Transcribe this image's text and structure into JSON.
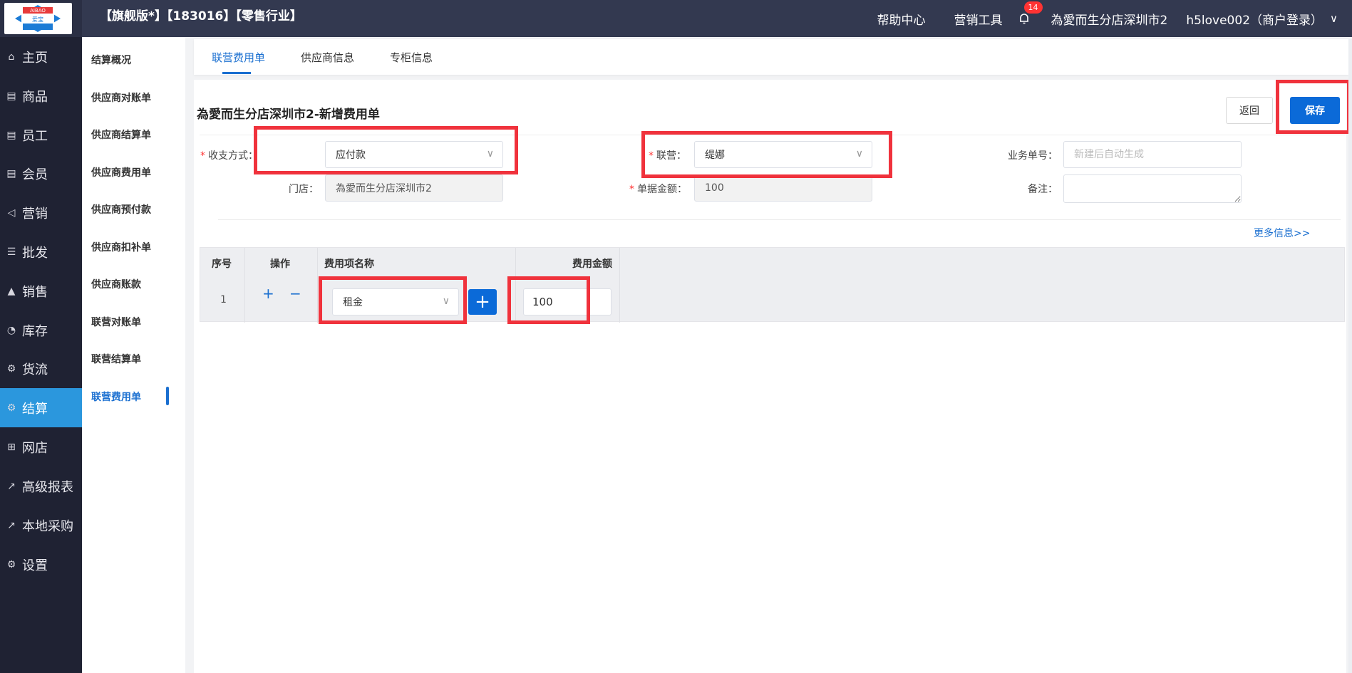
{
  "logo": {
    "top_text": "AIBAO",
    "bottom_text": "爱宝"
  },
  "header": {
    "brand": "【旗舰版*】【183016】【零售行业】",
    "help": "帮助中心",
    "marketing_tools": "营销工具",
    "notification_count": "14",
    "store": "為愛而生分店深圳市2",
    "user": "h5love002（商户登录）",
    "user_chevron": "∨"
  },
  "nav": [
    {
      "label": "主页",
      "icon": "home-icon",
      "glyph": "⌂"
    },
    {
      "label": "商品",
      "icon": "goods-icon",
      "glyph": "▤"
    },
    {
      "label": "员工",
      "icon": "staff-icon",
      "glyph": "▤"
    },
    {
      "label": "会员",
      "icon": "member-icon",
      "glyph": "▤"
    },
    {
      "label": "营销",
      "icon": "megaphone-icon",
      "glyph": "◁"
    },
    {
      "label": "批发",
      "icon": "wholesale-icon",
      "glyph": "☰"
    },
    {
      "label": "销售",
      "icon": "sales-chart-icon",
      "glyph": "▲"
    },
    {
      "label": "库存",
      "icon": "pie-chart-icon",
      "glyph": "◔"
    },
    {
      "label": "货流",
      "icon": "logistics-icon",
      "glyph": "⚙"
    },
    {
      "label": "结算",
      "icon": "settlement-icon",
      "glyph": "⚙"
    },
    {
      "label": "网店",
      "icon": "gift-icon",
      "glyph": "⊞"
    },
    {
      "label": "高级报表",
      "icon": "line-chart-icon",
      "glyph": "↗"
    },
    {
      "label": "本地采购",
      "icon": "purchase-chart-icon",
      "glyph": "↗"
    },
    {
      "label": "设置",
      "icon": "gear-icon",
      "glyph": "⚙"
    }
  ],
  "subnav": [
    "结算概况",
    "供应商对账单",
    "供应商结算单",
    "供应商费用单",
    "供应商预付款",
    "供应商扣补单",
    "供应商账款",
    "联营对账单",
    "联营结算单",
    "联营费用单"
  ],
  "tabs": [
    "联营费用单",
    "供应商信息",
    "专柜信息"
  ],
  "page": {
    "title": "為愛而生分店深圳市2-新增费用单",
    "back_label": "返回",
    "save_label": "保存"
  },
  "form": {
    "payment_method_label": "收支方式：",
    "payment_method_value": "应付款",
    "joint_label": "联营：",
    "joint_value": "缇娜",
    "bizno_label": "业务单号：",
    "bizno_placeholder": "新建后自动生成",
    "store_label": "门店：",
    "store_value": "為愛而生分店深圳市2",
    "amount_label": "单据金额：",
    "amount_value": "100",
    "remark_label": "备注：",
    "more_info": "更多信息>>"
  },
  "table": {
    "headers": [
      "序号",
      "操作",
      "费用项名称",
      "费用金额"
    ],
    "rows": [
      {
        "index": "1",
        "plus": "+",
        "minus": "−",
        "item": "租金",
        "amount": "100"
      }
    ],
    "add_item_symbol": "+"
  },
  "colors": {
    "header_bg": "#333950",
    "nav_bg": "#1f2233",
    "active_nav": "#2b97dd",
    "primary": "#0b6ad8",
    "highlight": "#f0323c"
  }
}
